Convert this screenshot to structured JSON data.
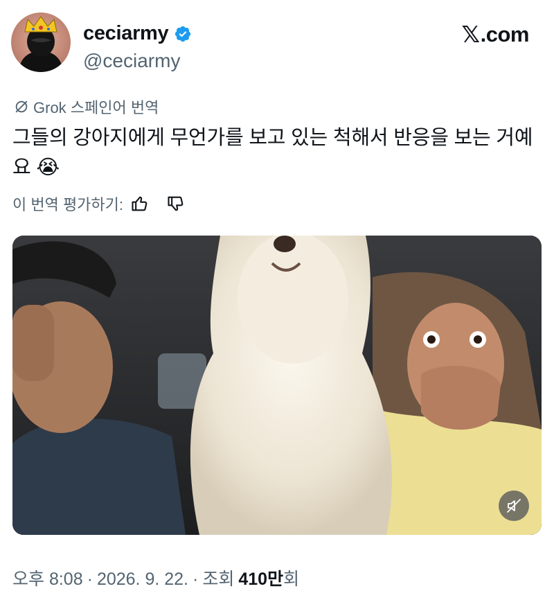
{
  "author": {
    "display_name": "ceciarmy",
    "handle": "@ceciarmy",
    "verified": true,
    "avatar": "crowned-masked-figure"
  },
  "site": {
    "label": ".com",
    "logo": "x-logo"
  },
  "translation": {
    "label": "Grok 스페인어 번역",
    "icon": "no-translate-icon"
  },
  "tweet": {
    "text": "그들의 강아지에게 무언가를 보고 있는 척해서 반응을 보는 거예요 😭"
  },
  "rate": {
    "label": "이 번역 평가하기:",
    "up_icon": "thumbs-up-icon",
    "down_icon": "thumbs-down-icon"
  },
  "media": {
    "type": "video",
    "description_icon": "muted-speaker-icon"
  },
  "meta": {
    "time": "오후 8:08",
    "date": "2026. 9. 22.",
    "views_label": "조회",
    "views_number": "410",
    "views_unit": "만",
    "views_suffix": "회",
    "sep": "·"
  },
  "colors": {
    "text": "#0f1419",
    "secondary": "#536471",
    "verified": "#1d9bf0"
  }
}
